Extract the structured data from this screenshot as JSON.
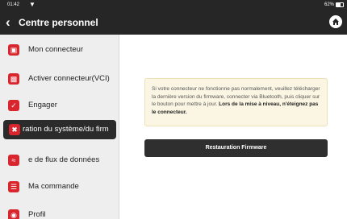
{
  "status_bar": {
    "time": "01:42",
    "battery": "62%"
  },
  "header": {
    "title": "Centre personnel"
  },
  "sidebar": {
    "items": [
      {
        "label": "Mon connecteur",
        "icon": "connector-icon"
      },
      {
        "label": "Activer connecteur(VCI)",
        "icon": "vci-icon"
      },
      {
        "label": "Engager",
        "icon": "shield-icon"
      },
      {
        "label": "ration du système/du firm",
        "icon": "tools-icon",
        "active": true
      },
      {
        "label": "e de flux de données",
        "icon": "data-flow-icon"
      },
      {
        "label": "Ma commande",
        "icon": "order-icon"
      },
      {
        "label": "Profil",
        "icon": "profile-icon"
      }
    ]
  },
  "main": {
    "info_text": "Si votre connecteur ne fonctionne pas normalement, veuillez télécharger la dernière version du firmware, connecter via Bluetooth, puis cliquer sur le bouton pour mettre à jour.",
    "info_bold": "Lors de la mise à niveau, n'éteignez pas le connecteur.",
    "button_label": "Restauration Firmware"
  },
  "colors": {
    "header_bg": "#262626",
    "icon_red": "#d9262e",
    "info_bg": "#fbf6e3"
  }
}
